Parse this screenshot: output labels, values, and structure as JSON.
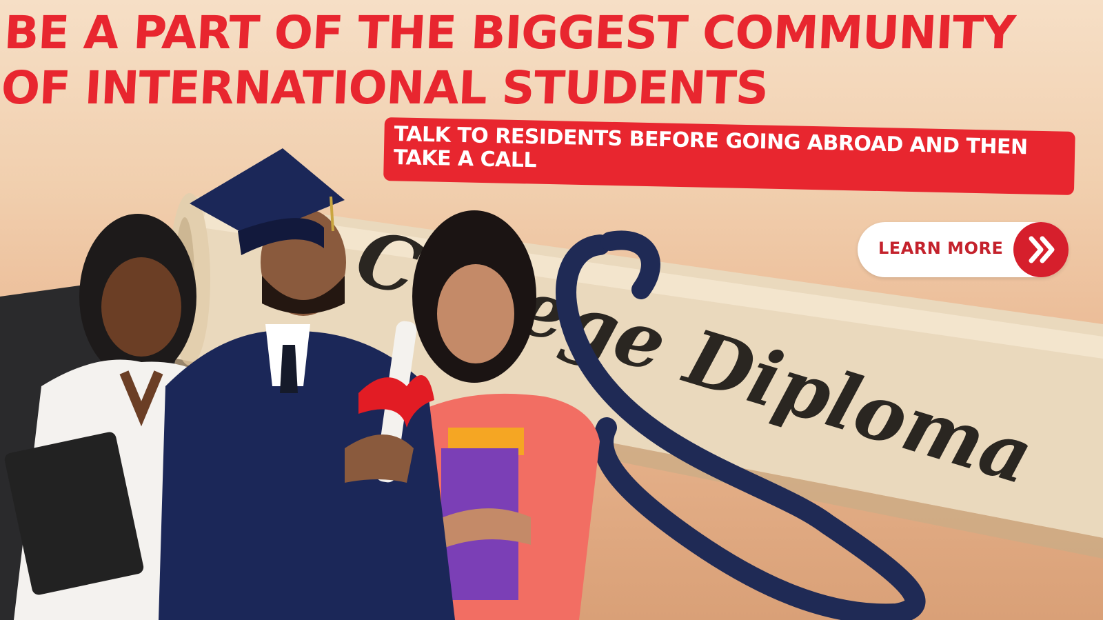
{
  "banner": {
    "headline": "BE A PART OF THE BIGGEST COMMUNITY OF INTERNATIONAL STUDENTS",
    "subline": "TALK TO RESIDENTS BEFORE GOING ABROAD AND THEN TAKE A CALL",
    "cta_label": "LEARN MORE",
    "cta_icon": "double-chevron-right-icon",
    "diploma_text": "College Diploma"
  },
  "colors": {
    "brand_red": "#e8262f",
    "cta_bg": "#ffffff",
    "cta_icon_bg": "#d61f2c",
    "ribbon": "#1f2a55"
  }
}
